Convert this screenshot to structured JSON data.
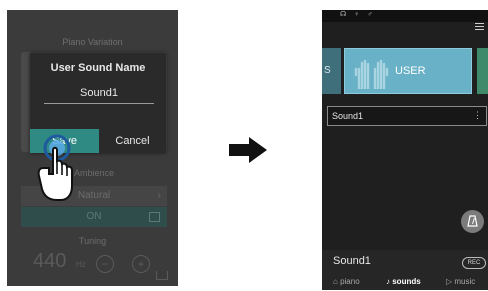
{
  "left_screen": {
    "header": "Piano Variation",
    "ambience": {
      "title": "Ambience",
      "value": "Natural",
      "toggle": "ON"
    },
    "tuning": {
      "title": "Tuning",
      "value": "440",
      "unit": "Hz"
    },
    "dialog": {
      "title": "User Sound Name",
      "input_value": "Sound1",
      "save_label": "Save",
      "cancel_label": "Cancel"
    }
  },
  "right_screen": {
    "prev_category_label": "S",
    "category_label": "USER",
    "sound_list": [
      "Sound1"
    ],
    "current_sound": "Sound1",
    "rec_label": "REC",
    "tabs": [
      {
        "label": "piano",
        "active": false
      },
      {
        "label": "sounds",
        "active": true
      },
      {
        "label": "music",
        "active": false
      }
    ]
  },
  "colors": {
    "accent_teal": "#2f8a84",
    "user_tile": "#69b1c6"
  }
}
